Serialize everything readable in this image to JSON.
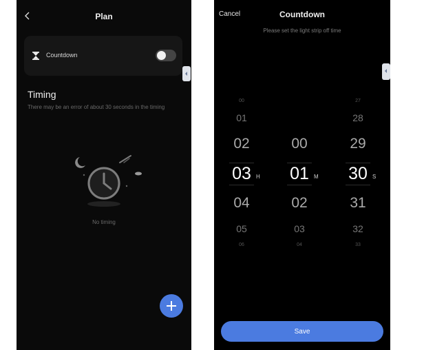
{
  "plan": {
    "title": "Plan",
    "countdown_label": "Countdown",
    "countdown_enabled": false,
    "timing_heading": "Timing",
    "timing_note": "There may be an error of about 30 seconds in the timing",
    "empty_text": "No timing",
    "add_label": "+"
  },
  "countdown": {
    "cancel": "Cancel",
    "title": "Countdown",
    "subtitle": "Please set the light strip off time",
    "save": "Save",
    "hours": {
      "values": [
        "00",
        "01",
        "02",
        "03",
        "04",
        "05",
        "06"
      ],
      "selected": "03",
      "unit": "H"
    },
    "minutes": {
      "values": [
        "00",
        "01",
        "02",
        "03",
        "04"
      ],
      "selected": "01",
      "unit": "M"
    },
    "seconds": {
      "values": [
        "27",
        "28",
        "29",
        "30",
        "31",
        "32",
        "33"
      ],
      "selected": "30",
      "unit": "S"
    }
  },
  "colors": {
    "accent": "#4b7be0",
    "screen_bg": "#0a0a0a",
    "card_bg": "#161616"
  }
}
